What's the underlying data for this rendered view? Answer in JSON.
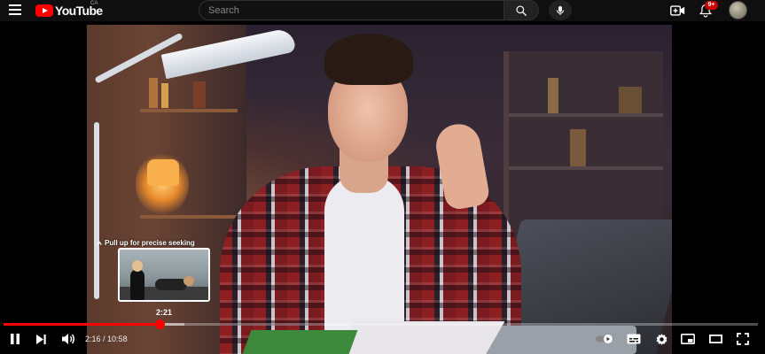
{
  "header": {
    "logo_text": "YouTube",
    "logo_country": "CA",
    "search_placeholder": "Search",
    "notification_badge": "9+"
  },
  "player": {
    "seek_tooltip": "Pull up for precise seeking",
    "seek_preview_time": "2:21",
    "current_time": "2:16",
    "time_separator": " / ",
    "duration": "10:58",
    "progress_fraction": 0.207,
    "buffered_fraction": 0.24,
    "accent_color": "#ff0000"
  },
  "icons": {
    "menu": "hamburger-menu-icon",
    "search": "search-icon",
    "mic": "microphone-icon",
    "create": "create-video-icon",
    "notifications": "bell-icon",
    "pause": "pause-icon",
    "next": "next-icon",
    "volume": "volume-icon",
    "autoplay": "autoplay-toggle-icon",
    "captions": "subtitles-icon",
    "settings": "gear-icon",
    "miniplayer": "miniplayer-icon",
    "theater": "theater-mode-icon",
    "fullscreen": "fullscreen-icon"
  }
}
